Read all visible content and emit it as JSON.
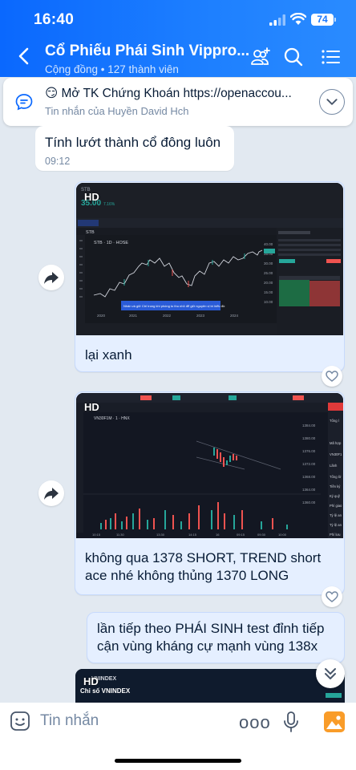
{
  "status_bar": {
    "time": "16:40",
    "battery": "74"
  },
  "header": {
    "title": "Cổ Phiếu Phái Sinh Vippro...",
    "subtitle": "Cộng đồng • 127 thành viên"
  },
  "pinned": {
    "text": "😏 Mở TK Chứng Khoán https://openaccou...",
    "sender": "Tin nhắn của Huyền David Hch"
  },
  "messages": [
    {
      "text": "Tính lướt thành cổ đông luôn",
      "time": "09:12"
    },
    {
      "image_label": "HD",
      "chart_header_price": "35.00",
      "chart_header_change": "7.16%",
      "chart_symbol": "STB · 1D · HOSE",
      "notice": "Nhấn và giữ Ctrl trong khi phóng to thu nhỏ để giữ nguyên vị trí biểu đồ",
      "price_labels": [
        "40.00",
        "35.00",
        "30.00",
        "25.00",
        "20.00",
        "15.00",
        "10.00"
      ],
      "year_labels": [
        "2020",
        "2021",
        "2022",
        "2023",
        "2024"
      ],
      "caption": "lại xanh",
      "colors": {
        "up": "#26a69a",
        "down": "#ef5350"
      }
    },
    {
      "image_label": "HD",
      "chart_symbol": "VN30F1M · 1 · HNX",
      "price_labels": [
        "1384.00",
        "1380.00",
        "1376.00",
        "1372.00",
        "1368.00",
        "1364.00",
        "1360.00"
      ],
      "time_labels": [
        "10:15",
        "11:30",
        "13:30",
        "14:15",
        "16",
        "09:15",
        "09:30",
        "10:00"
      ],
      "caption": "không qua 1378 SHORT, TREND short ace nhé không thủng 1370 LONG",
      "side_labels": [
        "Tổng l",
        "Mã hợp",
        "VN30F1",
        "Lãnh",
        "Tổng lớ",
        "Tiền ký",
        "Ký quỹ",
        "Phí giao",
        "Tỷ lệ an",
        "Tỷ lệ an",
        "Phí lưu"
      ]
    },
    {
      "text": "lần tiếp theo PHÁI SINH test đỉnh tiếp cận vùng kháng cự mạnh vùng 138x"
    },
    {
      "image_label": "HD",
      "title": "Chỉ số VNINDEX",
      "name_header": "VNINDEX"
    }
  ],
  "input": {
    "placeholder": "Tin nhắn",
    "more": "ooo"
  }
}
